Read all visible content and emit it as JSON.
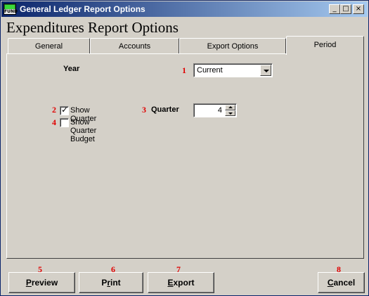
{
  "window": {
    "title": "General Ledger Report Options",
    "icon_text": "FUND",
    "controls": [
      "_",
      "□",
      "×"
    ]
  },
  "heading": "Expenditures Report Options",
  "tabs": [
    {
      "label": "General",
      "active": false
    },
    {
      "label": "Accounts",
      "active": false
    },
    {
      "label": "Export Options",
      "active": false
    },
    {
      "label": "Period",
      "active": true
    }
  ],
  "period": {
    "year": {
      "number": "1",
      "label": "Year",
      "value": "Current"
    },
    "show_quarter": {
      "number": "2",
      "label": "Show Quarter",
      "checked": true,
      "mark": "✓"
    },
    "quarter": {
      "number": "3",
      "label": "Quarter",
      "value": "4"
    },
    "show_quarter_budget": {
      "number": "4",
      "label": "Show Quarter Budget",
      "checked": false
    }
  },
  "buttons": [
    {
      "number": "5",
      "underline": "P",
      "rest": "review"
    },
    {
      "number": "6",
      "underline": "",
      "pre": "P",
      "u": "r",
      "rest": "int"
    },
    {
      "number": "7",
      "underline": "E",
      "rest": "xport"
    },
    {
      "number": "8",
      "underline": "C",
      "rest": "ancel"
    }
  ],
  "colors": {
    "annotation": "#e00000",
    "titlebar_start": "#0a246a",
    "titlebar_end": "#a6caf0",
    "face": "#d4d0c8"
  }
}
